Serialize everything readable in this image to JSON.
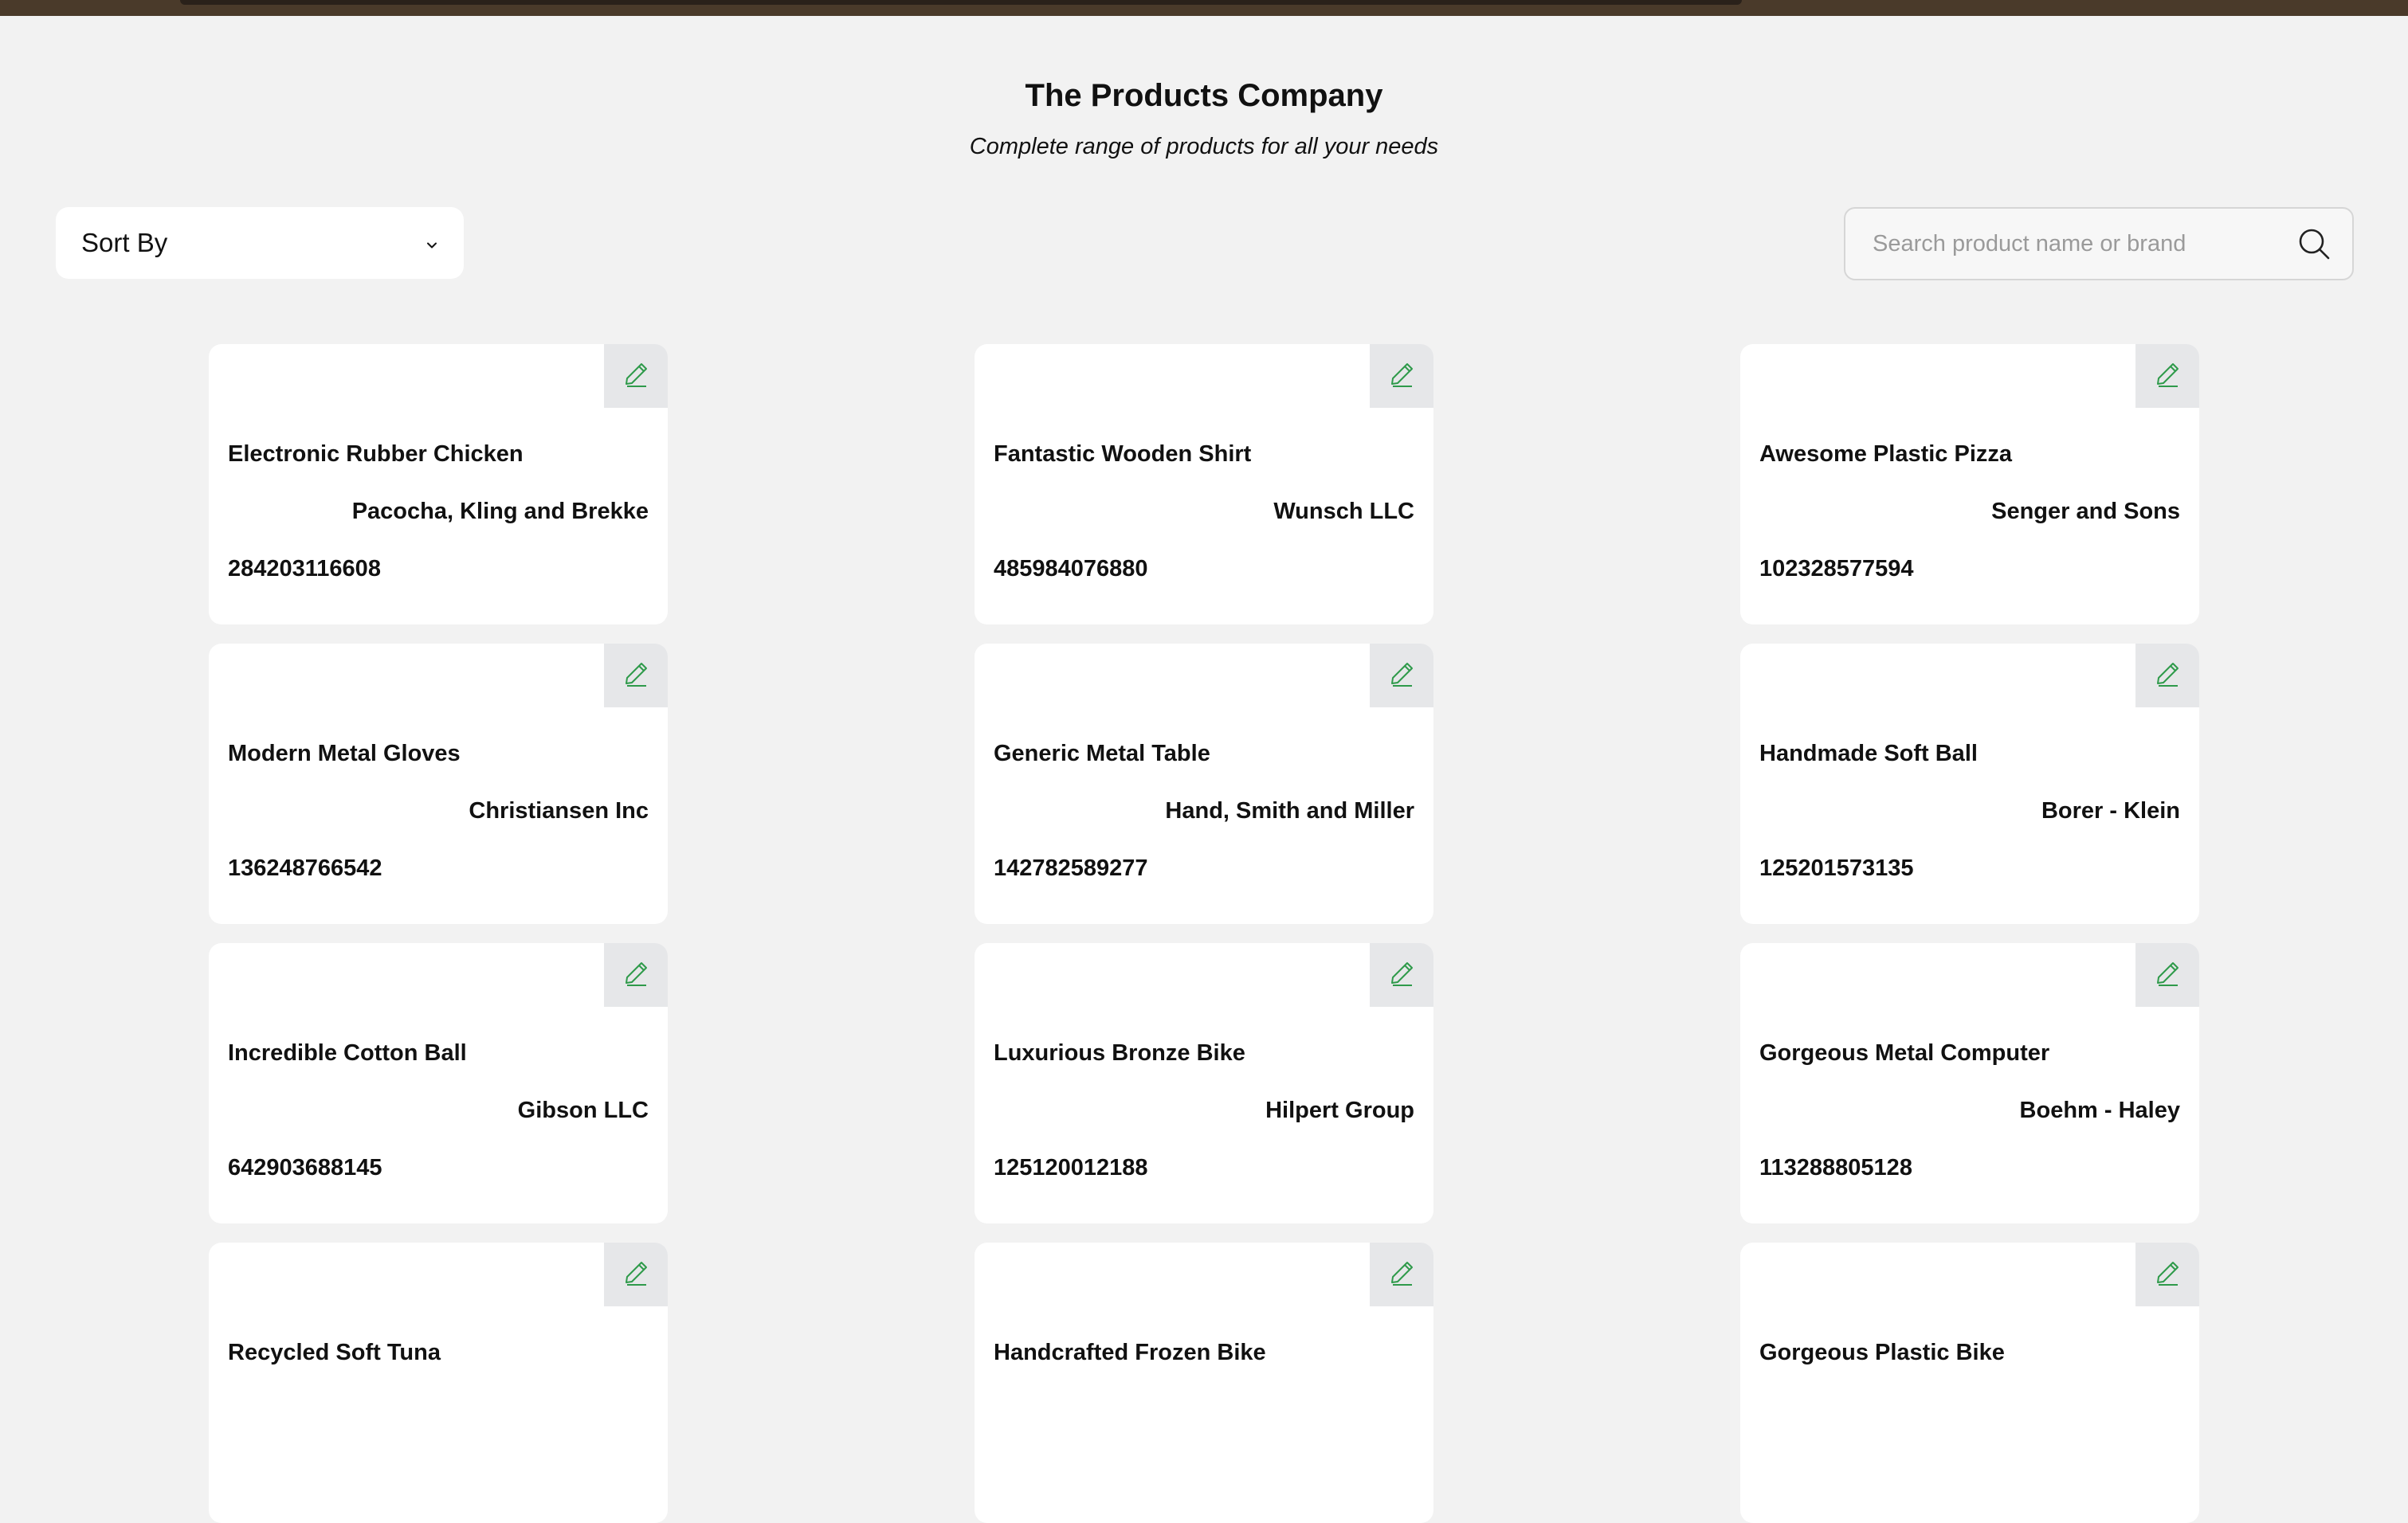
{
  "header": {
    "title": "The Products Company",
    "subtitle": "Complete range of products for all your needs"
  },
  "toolbar": {
    "sort_label": "Sort By",
    "search_placeholder": "Search product name or brand",
    "search_value": ""
  },
  "colors": {
    "background": "#f2f2f2",
    "card": "#ffffff",
    "edit_button_bg": "#e6e7e9",
    "edit_icon": "#2e9a4a",
    "top_strip": "#4a3a2a"
  },
  "icons": {
    "sort": "chevron-down-icon",
    "search": "search-icon",
    "edit": "pencil-icon"
  },
  "products": [
    {
      "name": "Electronic Rubber Chicken",
      "brand": "Pacocha, Kling and Brekke",
      "code": "284203116608"
    },
    {
      "name": "Fantastic Wooden Shirt",
      "brand": "Wunsch LLC",
      "code": "485984076880"
    },
    {
      "name": "Awesome Plastic Pizza",
      "brand": "Senger and Sons",
      "code": "102328577594"
    },
    {
      "name": "Modern Metal Gloves",
      "brand": "Christiansen Inc",
      "code": "136248766542"
    },
    {
      "name": "Generic Metal Table",
      "brand": "Hand, Smith and Miller",
      "code": "142782589277"
    },
    {
      "name": "Handmade Soft Ball",
      "brand": "Borer - Klein",
      "code": "125201573135"
    },
    {
      "name": "Incredible Cotton Ball",
      "brand": "Gibson LLC",
      "code": "642903688145"
    },
    {
      "name": "Luxurious Bronze Bike",
      "brand": "Hilpert Group",
      "code": "125120012188"
    },
    {
      "name": "Gorgeous Metal Computer",
      "brand": "Boehm - Haley",
      "code": "113288805128"
    },
    {
      "name": "Recycled Soft Tuna",
      "brand": "",
      "code": ""
    },
    {
      "name": "Handcrafted Frozen Bike",
      "brand": "",
      "code": ""
    },
    {
      "name": "Gorgeous Plastic Bike",
      "brand": "",
      "code": ""
    }
  ]
}
